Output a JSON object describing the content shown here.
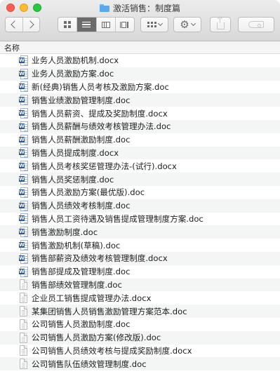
{
  "window": {
    "title": "激活销售：制度篇"
  },
  "toolbar": {
    "back": "back-icon",
    "forward": "forward-icon",
    "views": [
      "icon-view-icon",
      "list-view-icon",
      "column-view-icon",
      "coverflow-view-icon"
    ],
    "active_view": "list-view-icon",
    "arrange": "arrange-icon",
    "action": "gear-icon",
    "share": "share-icon",
    "tags": "tag-icon",
    "accent": "#5aaaeb"
  },
  "header": {
    "name_column": "名称"
  },
  "files": [
    {
      "name": "业务人员激励机制.docx",
      "icon": "word-doc-icon"
    },
    {
      "name": "业务人员激励方案.doc",
      "icon": "word-doc-icon"
    },
    {
      "name": "新(经典)销售人员考核及激励方案.doc",
      "icon": "word-doc-icon"
    },
    {
      "name": "销售业绩激励管理制度.doc",
      "icon": "word-doc-icon"
    },
    {
      "name": "销售人员薪资、提成及奖励制度.docx",
      "icon": "word-doc-icon"
    },
    {
      "name": "销售人员薪酬与绩效考核管理办法.doc",
      "icon": "word-doc-icon"
    },
    {
      "name": "销售人员薪酬激励制度.doc",
      "icon": "word-doc-icon"
    },
    {
      "name": "销售人员提成制度.docx",
      "icon": "word-doc-icon"
    },
    {
      "name": "销售人员考核奖惩管理办法-(试行).docx",
      "icon": "word-doc-icon"
    },
    {
      "name": "销售人员奖惩制度.doc",
      "icon": "word-doc-icon"
    },
    {
      "name": "销售人员激励方案(最优版).doc",
      "icon": "word-doc-icon"
    },
    {
      "name": "销售人员绩效考核制度.doc",
      "icon": "word-doc-icon"
    },
    {
      "name": "销售人员工资待遇及销售提成管理制度方案.doc",
      "icon": "word-doc-icon"
    },
    {
      "name": "销售激励制度.doc",
      "icon": "word-doc-icon"
    },
    {
      "name": "销售激励机制(草稿).doc",
      "icon": "word-doc-icon"
    },
    {
      "name": "销售部薪资及绩效考核管理制度.docx",
      "icon": "word-doc-icon"
    },
    {
      "name": "销售部提成及管理制度.doc",
      "icon": "word-doc-icon"
    },
    {
      "name": "销售部绩效管理制度.doc",
      "icon": "plain-doc-icon"
    },
    {
      "name": "企业员工销售提成管理办法.docx",
      "icon": "plain-doc-icon"
    },
    {
      "name": "某集团销售人员销售激励管理方案范本.doc",
      "icon": "plain-doc-icon"
    },
    {
      "name": "公司销售人员激励制度.doc",
      "icon": "plain-doc-icon"
    },
    {
      "name": "公司销售人员激励方案(修改版).doc",
      "icon": "plain-doc-icon"
    },
    {
      "name": "公司销售人员绩效考核与提成奖励制度.docx",
      "icon": "plain-doc-icon"
    },
    {
      "name": "公司销售队伍绩效管理制度.doc",
      "icon": "plain-doc-icon"
    }
  ]
}
